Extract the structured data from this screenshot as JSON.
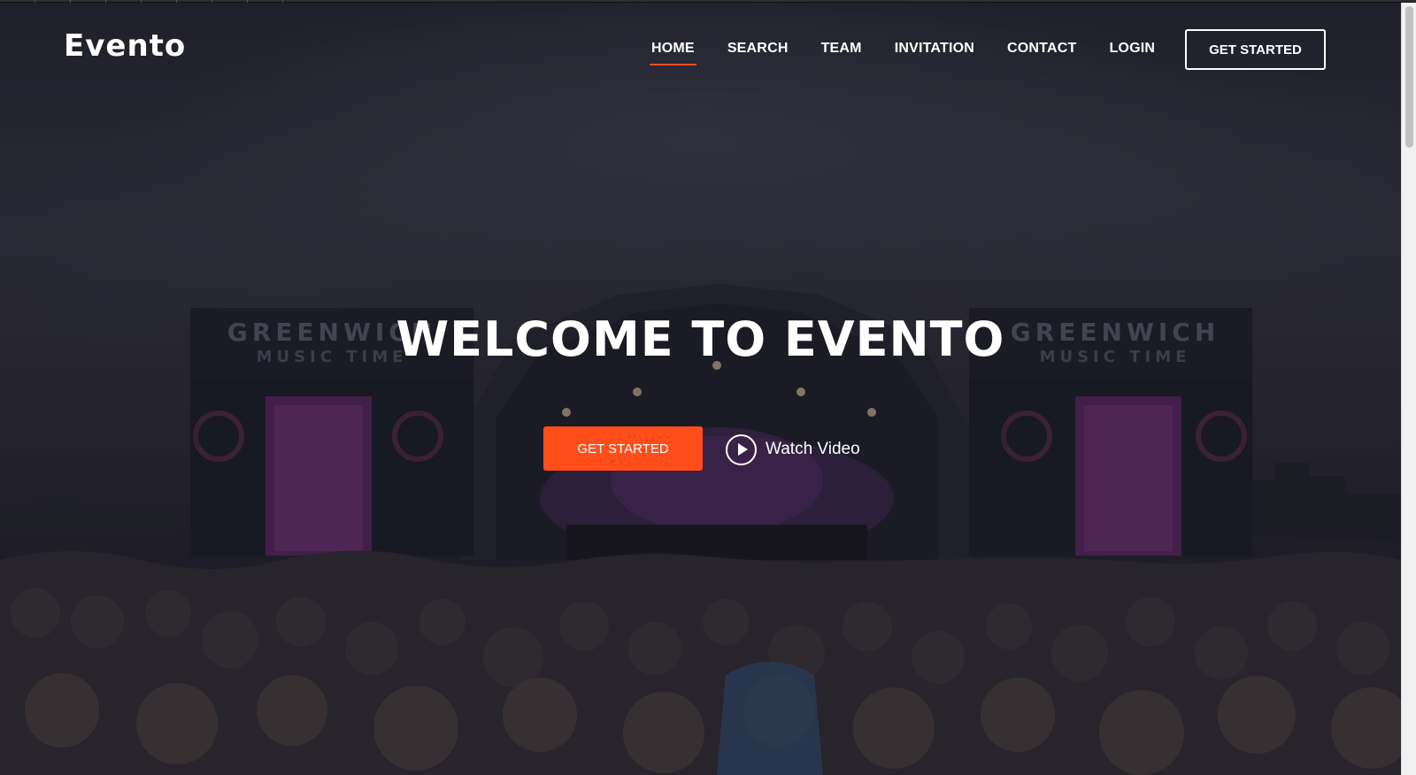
{
  "brand": {
    "logo": "Evento"
  },
  "nav": {
    "items": [
      {
        "label": "HOME",
        "active": true
      },
      {
        "label": "SEARCH",
        "active": false
      },
      {
        "label": "TEAM",
        "active": false
      },
      {
        "label": "INVITATION",
        "active": false
      },
      {
        "label": "CONTACT",
        "active": false
      },
      {
        "label": "LOGIN",
        "active": false
      }
    ],
    "cta_label": "GET STARTED"
  },
  "hero": {
    "title": "WELCOME TO EVENTO",
    "cta_label": "GET STARTED",
    "watch_label": "Watch Video",
    "background_text": [
      "GREENWICH",
      "MUSIC TIME",
      "GREENWICH",
      "MUSIC TIME"
    ]
  },
  "colors": {
    "accent": "#ff4e1a",
    "text": "#ffffff",
    "overlay": "#12121c"
  },
  "icons": {
    "play": "play-circle-icon"
  }
}
